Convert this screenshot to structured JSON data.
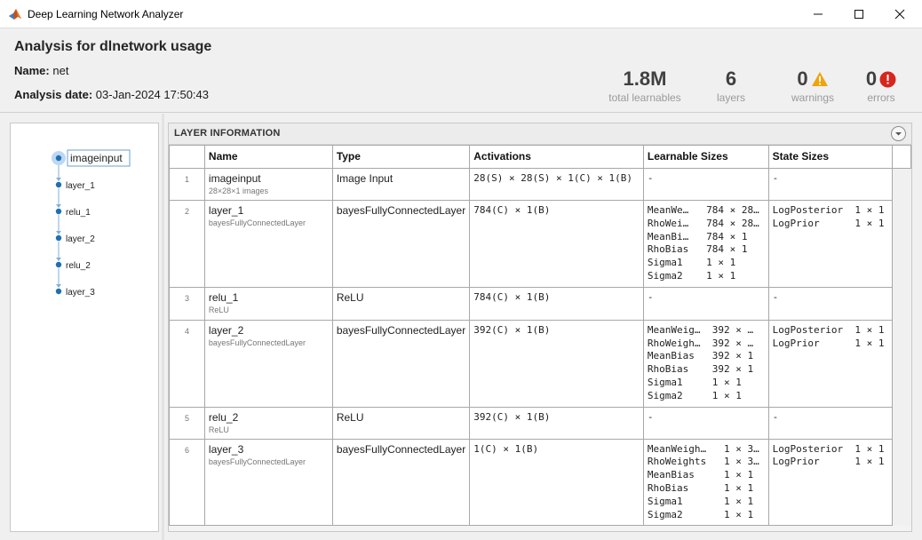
{
  "window": {
    "title": "Deep Learning Network Analyzer"
  },
  "header": {
    "title": "Analysis for dlnetwork usage",
    "name_label": "Name:",
    "name_value": "net",
    "date_label": "Analysis date:",
    "date_value": "03-Jan-2024 17:50:43"
  },
  "stats": {
    "learnables": {
      "value": "1.8M",
      "label": "total learnables"
    },
    "layers": {
      "value": "6",
      "label": "layers"
    },
    "warnings": {
      "value": "0",
      "label": "warnings",
      "icon": "warning-icon",
      "color": "#f0a30a"
    },
    "errors": {
      "value": "0",
      "label": "errors",
      "icon": "error-icon",
      "color": "#d7261e"
    }
  },
  "graph": {
    "accent": "#1f6fb2",
    "nodes": [
      {
        "label": "imageinput",
        "selected": true
      },
      {
        "label": "layer_1"
      },
      {
        "label": "relu_1"
      },
      {
        "label": "layer_2"
      },
      {
        "label": "relu_2"
      },
      {
        "label": "layer_3"
      }
    ]
  },
  "layer_info": {
    "section_title": "LAYER INFORMATION",
    "columns": [
      "Name",
      "Type",
      "Activations",
      "Learnable Sizes",
      "State Sizes"
    ],
    "rows": [
      {
        "index": "1",
        "name": "imageinput",
        "subtitle": "28×28×1 images",
        "type": "Image Input",
        "activations": "28(S) × 28(S) × 1(C) × 1(B)",
        "learnables": "-",
        "states": "-"
      },
      {
        "index": "2",
        "name": "layer_1",
        "subtitle": "bayesFullyConnectedLayer",
        "type": "bayesFullyConnectedLayer",
        "activations": "784(C) × 1(B)",
        "learnables": "MeanWe…   784 × 28…\nRhoWei…   784 × 28…\nMeanBi…   784 × 1\nRhoBias   784 × 1\nSigma1    1 × 1\nSigma2    1 × 1",
        "states": "LogPosterior  1 × 1\nLogPrior      1 × 1"
      },
      {
        "index": "3",
        "name": "relu_1",
        "subtitle": "ReLU",
        "type": "ReLU",
        "activations": "784(C) × 1(B)",
        "learnables": "-",
        "states": "-"
      },
      {
        "index": "4",
        "name": "layer_2",
        "subtitle": "bayesFullyConnectedLayer",
        "type": "bayesFullyConnectedLayer",
        "activations": "392(C) × 1(B)",
        "learnables": "MeanWeig…  392 × …\nRhoWeigh…  392 × …\nMeanBias   392 × 1\nRhoBias    392 × 1\nSigma1     1 × 1\nSigma2     1 × 1",
        "states": "LogPosterior  1 × 1\nLogPrior      1 × 1"
      },
      {
        "index": "5",
        "name": "relu_2",
        "subtitle": "ReLU",
        "type": "ReLU",
        "activations": "392(C) × 1(B)",
        "learnables": "-",
        "states": "-"
      },
      {
        "index": "6",
        "name": "layer_3",
        "subtitle": "bayesFullyConnectedLayer",
        "type": "bayesFullyConnectedLayer",
        "activations": "1(C) × 1(B)",
        "learnables": "MeanWeigh…   1 × 3…\nRhoWeights   1 × 3…\nMeanBias     1 × 1\nRhoBias      1 × 1\nSigma1       1 × 1\nSigma2       1 × 1",
        "states": "LogPosterior  1 × 1\nLogPrior      1 × 1"
      }
    ]
  }
}
